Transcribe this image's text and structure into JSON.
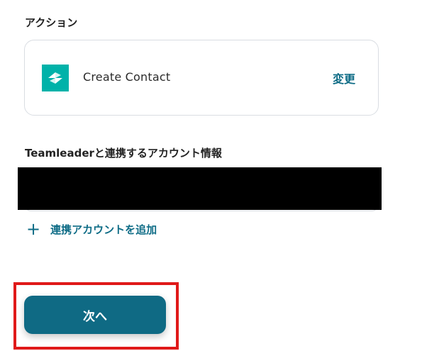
{
  "action_section": {
    "label": "アクション",
    "action_name": "Create Contact",
    "app_icon": "teamleader-logo-icon",
    "change_label": "変更"
  },
  "account_section": {
    "label": "Teamleaderと連携するアカウント情報",
    "add_account_label": "連携アカウントを追加",
    "add_icon": "plus-icon"
  },
  "footer": {
    "next_label": "次へ"
  },
  "colors": {
    "accent": "#0e6c86",
    "button": "#0f6a84",
    "app_icon_bg": "#00b2a9",
    "highlight": "#e01919"
  }
}
